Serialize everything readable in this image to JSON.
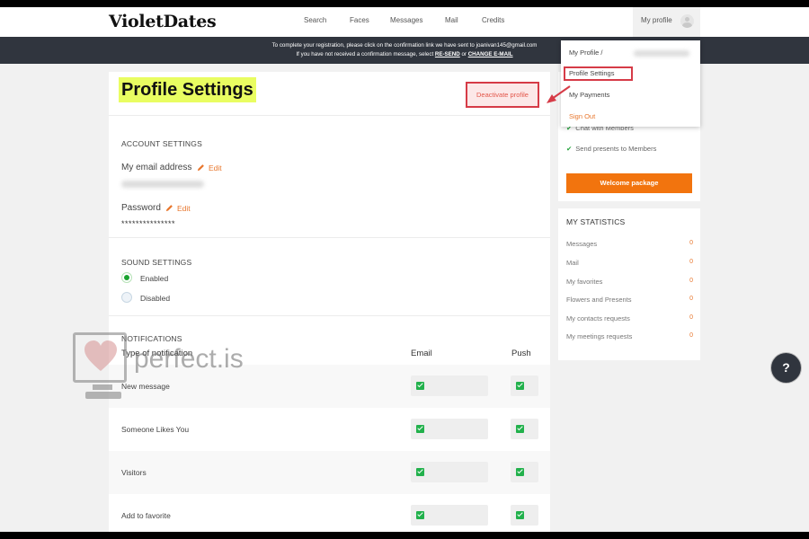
{
  "app": {
    "logo": "VioletDates"
  },
  "nav": {
    "items": [
      "Search",
      "Faces",
      "Messages",
      "Mail",
      "Credits"
    ],
    "my_profile": "My profile"
  },
  "banner": {
    "line1": "To complete your registration, please click on the confirmation link we have sent to joanivan145@gmail.com",
    "line2_prefix": "If you have not received a confirmation message, select ",
    "resend": "RE-SEND",
    "or": " or ",
    "change_email": "CHANGE E-MAIL"
  },
  "page": {
    "title": "Profile Settings",
    "deactivate": "Deactivate profile"
  },
  "account": {
    "title": "ACCOUNT SETTINGS",
    "email_label": "My email address",
    "edit": "Edit",
    "password_label": "Password",
    "password_value": "***************"
  },
  "sound": {
    "title": "SOUND SETTINGS",
    "options": [
      "Enabled",
      "Disabled"
    ],
    "selected": "Enabled"
  },
  "notifications": {
    "title": "NOTIFICATIONS",
    "col_type": "Type of notification",
    "col_email": "Email",
    "col_push": "Push",
    "rows": [
      {
        "label": "New message",
        "email": true,
        "push": true
      },
      {
        "label": "Someone Likes You",
        "email": true,
        "push": true
      },
      {
        "label": "Visitors",
        "email": true,
        "push": true
      },
      {
        "label": "Add to favorite",
        "email": true,
        "push": true
      }
    ]
  },
  "dropdown": {
    "items": [
      "My Profile /",
      "Profile Settings",
      "My Payments",
      "Sign Out"
    ]
  },
  "features": {
    "items": [
      "Chat with Members",
      "Send presents to Members"
    ],
    "welcome": "Welcome package"
  },
  "stats": {
    "title": "MY STATISTICS",
    "items": [
      {
        "label": "Messages",
        "value": "0"
      },
      {
        "label": "Mail",
        "value": "0"
      },
      {
        "label": "My favorites",
        "value": "0"
      },
      {
        "label": "Flowers and Presents",
        "value": "0"
      },
      {
        "label": "My contacts requests",
        "value": "0"
      },
      {
        "label": "My meetings requests",
        "value": "0"
      }
    ]
  },
  "help": {
    "label": "?"
  },
  "watermark": {
    "text": "perfect.is"
  },
  "colors": {
    "accent": "#f2740e",
    "highlight": "#e9fd61",
    "alert_red": "#d63b47",
    "check_green": "#22b14c",
    "banner_bg": "#30353e"
  }
}
